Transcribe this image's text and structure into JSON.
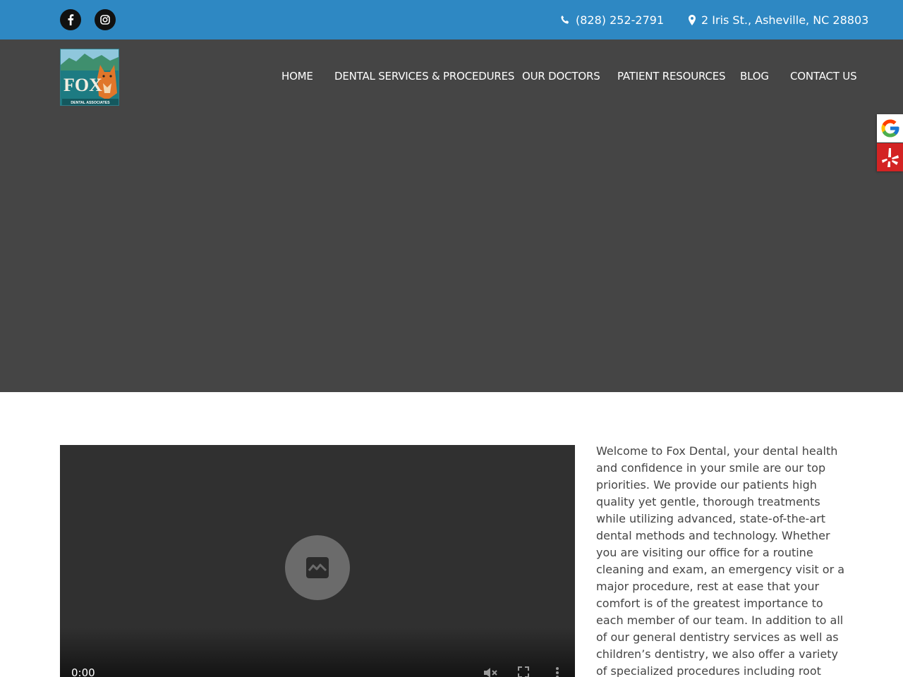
{
  "topbar": {
    "phone": "(828) 252-2791",
    "address": "2 Iris St., Asheville, NC 28803",
    "social": [
      {
        "name": "facebook-icon"
      },
      {
        "name": "instagram-icon"
      }
    ]
  },
  "logo": {
    "brand": "FOX",
    "subtitle": "DENTAL ASSOCIATES"
  },
  "nav": {
    "items": [
      {
        "label": "HOME"
      },
      {
        "label": "DENTAL SERVICES & PROCEDURES"
      },
      {
        "label": "OUR DOCTORS"
      },
      {
        "label": "PATIENT RESOURCES"
      },
      {
        "label": "BLOG"
      },
      {
        "label": "CONTACT US"
      }
    ]
  },
  "video": {
    "time": "0:00"
  },
  "intro": {
    "text": "Welcome to Fox Dental, your dental health and confidence in your smile are our top priorities. We provide our patients high quality yet gentle, thorough treatments while utilizing advanced, state-of-the-art dental methods and technology. Whether you are visiting our office for a routine cleaning and exam, an emergency visit or a major procedure, rest at ease that your comfort is of the greatest importance to each member of our team. In addition to all of our general dentistry services as well as children’s dentistry, we also offer a variety of specialized procedures including root canals, dental"
  },
  "colors": {
    "topbar": "#2e88c3",
    "header": "#454545",
    "yelp": "#d32323"
  }
}
